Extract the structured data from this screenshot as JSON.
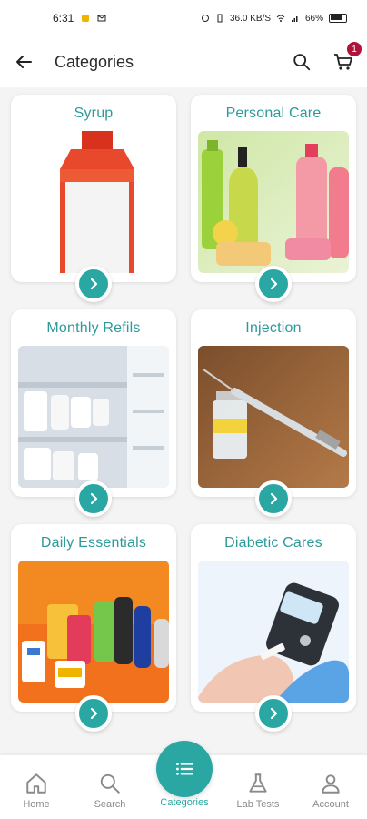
{
  "status_bar": {
    "time": "6:31",
    "network": "36.0 KB/S",
    "battery": "66%"
  },
  "app_bar": {
    "title": "Categories",
    "cart_badge": "1"
  },
  "categories": [
    {
      "label": "Syrup"
    },
    {
      "label": "Personal Care"
    },
    {
      "label": "Monthly Refils"
    },
    {
      "label": "Injection"
    },
    {
      "label": "Daily Essentials"
    },
    {
      "label": "Diabetic Cares"
    }
  ],
  "bottom_nav": [
    {
      "label": "Home",
      "icon": "home-icon"
    },
    {
      "label": "Search",
      "icon": "search-icon"
    },
    {
      "label": "Categories",
      "icon": "list-icon"
    },
    {
      "label": "Lab Tests",
      "icon": "flask-icon"
    },
    {
      "label": "Account",
      "icon": "user-icon"
    }
  ],
  "colors": {
    "accent": "#2aa7a3",
    "title_text": "#2d9a9a",
    "badge": "#b1123a"
  }
}
